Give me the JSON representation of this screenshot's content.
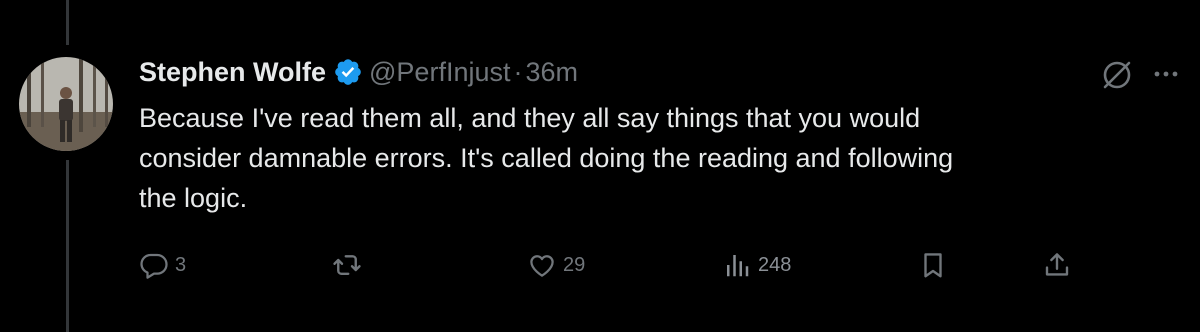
{
  "tweet": {
    "author_name": "Stephen Wolfe",
    "handle": "@PerfInjust",
    "separator": "·",
    "time": "36m",
    "text_lines": [
      "Because I've read them all, and they all say things that you would",
      "consider damnable errors. It's called doing the reading and following",
      "the logic."
    ],
    "verified": true
  },
  "icons": {
    "verified": "verified-badge-icon",
    "grok": "grok-icon",
    "more": "more-icon",
    "reply": "reply-icon",
    "repost": "repost-icon",
    "like": "like-icon",
    "views": "views-icon",
    "bookmark": "bookmark-icon",
    "share": "share-icon"
  },
  "actions": {
    "reply_count": "3",
    "like_count": "29",
    "views_count": "248"
  },
  "colors": {
    "background": "#000000",
    "primary_text": "#e7e9ea",
    "secondary_text": "#71767b",
    "verified_blue": "#1d9bf0"
  }
}
